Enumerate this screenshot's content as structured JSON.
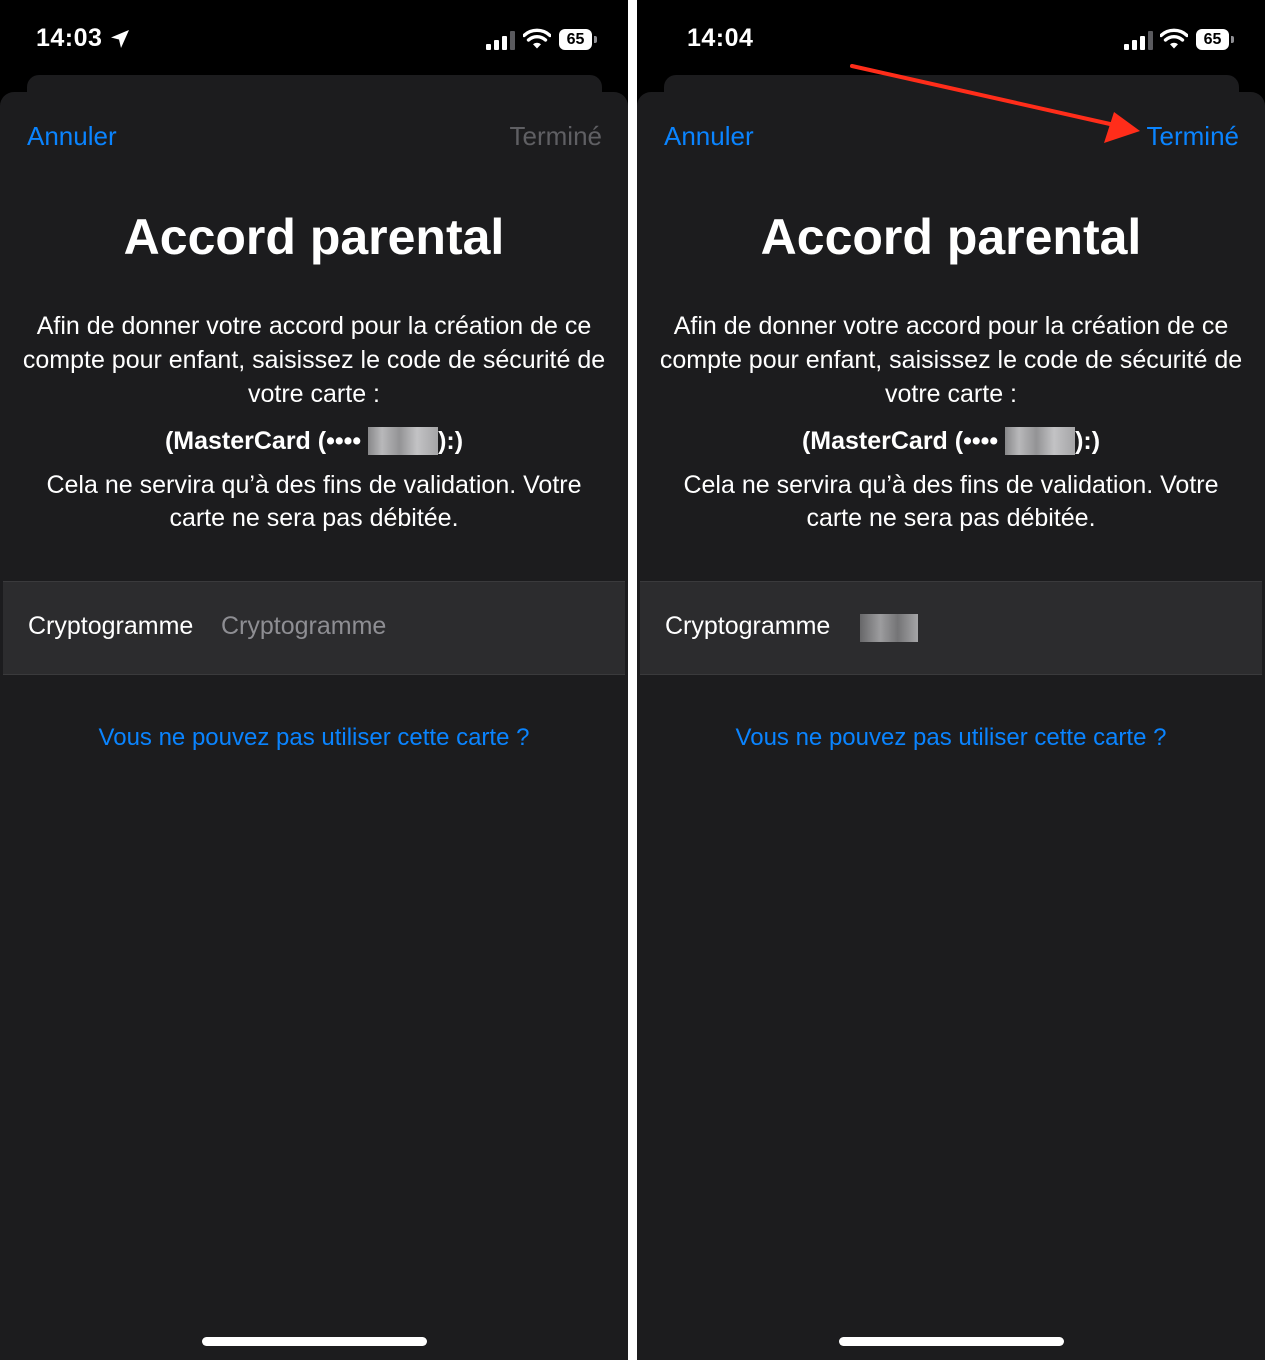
{
  "colors": {
    "accent": "#0a84ff",
    "disabled": "#5f5f63",
    "sheet_bg": "#1c1c1e",
    "field_bg": "#2c2c2e",
    "annotation_arrow": "#ff2d1a"
  },
  "left": {
    "status": {
      "time": "14:03",
      "battery": "65",
      "location_icon": "location-arrow-icon"
    },
    "nav": {
      "cancel": "Annuler",
      "done": "Terminé",
      "done_state": "disabled"
    },
    "title": "Accord parental",
    "description": "Afin de donner votre accord pour la création de ce compte pour enfant, saisissez le code de sécurité de votre carte :",
    "card": {
      "prefix": "(MasterCard (••••",
      "suffix": "):)"
    },
    "note": "Cela ne servira qu’à des fins de validation. Votre carte ne sera pas débitée.",
    "field": {
      "label": "Cryptogramme",
      "placeholder": "Cryptogramme",
      "value": ""
    },
    "link": "Vous ne pouvez pas utiliser cette carte ?"
  },
  "right": {
    "status": {
      "time": "14:04",
      "battery": "65"
    },
    "nav": {
      "cancel": "Annuler",
      "done": "Terminé",
      "done_state": "enabled"
    },
    "title": "Accord parental",
    "description": "Afin de donner votre accord pour la création de ce compte pour enfant, saisissez le code de sécurité de votre carte :",
    "card": {
      "prefix": "(MasterCard (••••",
      "suffix": "):)"
    },
    "note": "Cela ne servira qu’à des fins de validation. Votre carte ne sera pas débitée.",
    "field": {
      "label": "Cryptogramme",
      "value_state": "masked"
    },
    "link": "Vous ne pouvez pas utiliser cette carte ?"
  }
}
